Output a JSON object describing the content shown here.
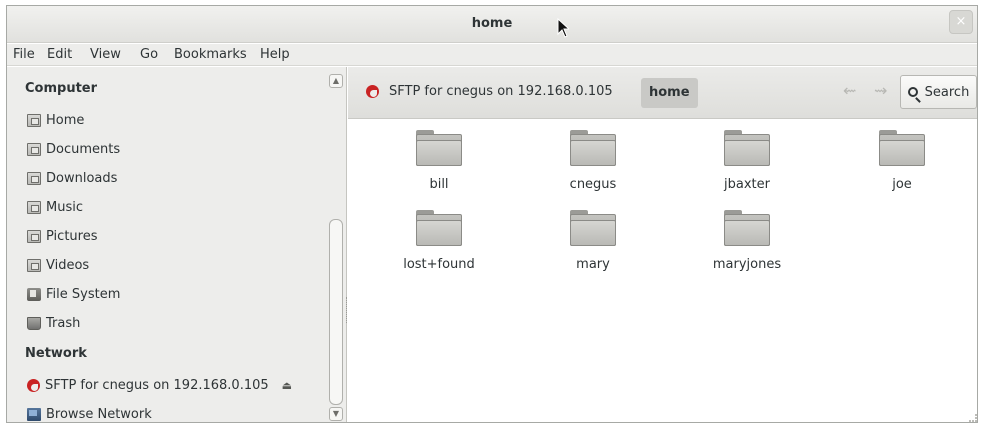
{
  "window": {
    "title": "home",
    "close_glyph": "×"
  },
  "menubar": {
    "items": [
      "File",
      "Edit",
      "View",
      "Go",
      "Bookmarks",
      "Help"
    ]
  },
  "sidebar": {
    "computer_heading": "Computer",
    "computer_items": [
      {
        "label": "Home",
        "icon": "home-folder-icon"
      },
      {
        "label": "Documents",
        "icon": "documents-folder-icon"
      },
      {
        "label": "Downloads",
        "icon": "downloads-folder-icon"
      },
      {
        "label": "Music",
        "icon": "music-folder-icon"
      },
      {
        "label": "Pictures",
        "icon": "pictures-folder-icon"
      },
      {
        "label": "Videos",
        "icon": "videos-folder-icon"
      },
      {
        "label": "File System",
        "icon": "filesystem-icon"
      },
      {
        "label": "Trash",
        "icon": "trash-icon"
      }
    ],
    "network_heading": "Network",
    "network_items": [
      {
        "label": "SFTP for cnegus on 192.168.0.105",
        "icon": "sftp-icon",
        "eject": "⏏"
      },
      {
        "label": "Browse Network",
        "icon": "network-icon"
      }
    ],
    "scroll_up": "▲",
    "scroll_down": "▼"
  },
  "pathbar": {
    "location": "SFTP for cnegus on 192.168.0.105",
    "current": "home",
    "back": "⇜",
    "forward": "⇝",
    "search_label": "Search"
  },
  "files": [
    "bill",
    "cnegus",
    "jbaxter",
    "joe",
    "lost+found",
    "mary",
    "maryjones"
  ],
  "colors": {
    "sftp_red": "#c92323",
    "selected_crumb": "#c9c9c6"
  }
}
